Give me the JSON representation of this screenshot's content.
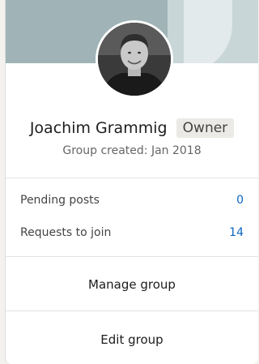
{
  "profile": {
    "name": "Joachim Grammig",
    "role_badge": "Owner",
    "created": "Group created: Jan 2018"
  },
  "stats": [
    {
      "label": "Pending posts",
      "value": "0"
    },
    {
      "label": "Requests to join",
      "value": "14"
    }
  ],
  "actions": {
    "manage": "Manage group",
    "edit": "Edit group"
  },
  "colors": {
    "link": "#0a66c2",
    "cover": "#a0b4b7"
  }
}
